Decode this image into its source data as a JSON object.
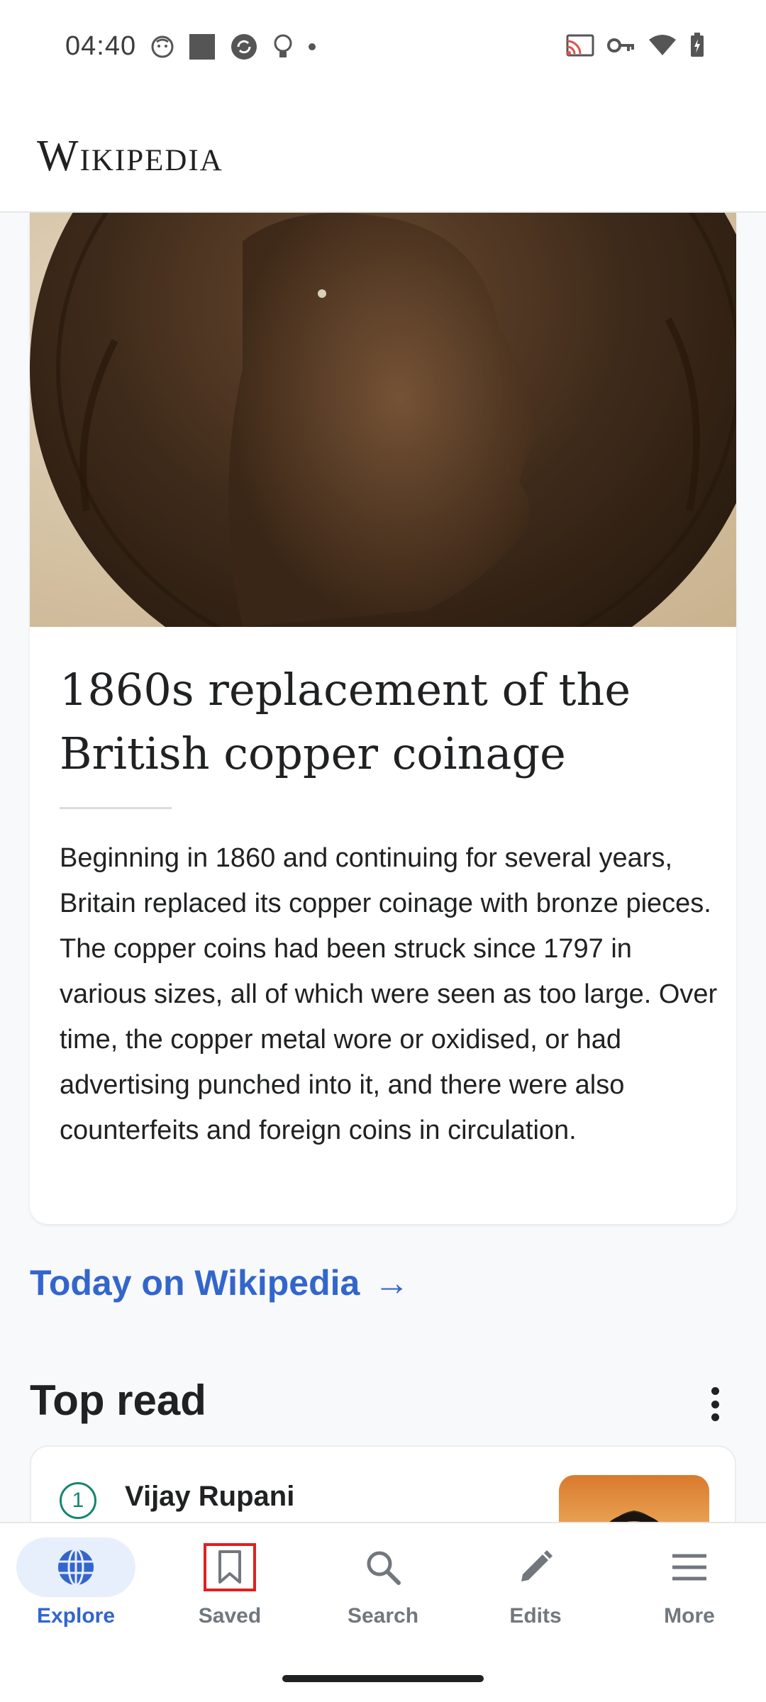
{
  "status_bar": {
    "time": "04:40"
  },
  "header": {
    "wordmark": "Wikipedia"
  },
  "featured": {
    "title": "1860s replacement of the British copper coinage",
    "extract": "Beginning in 1860 and continuing for several years, Britain replaced its copper coinage with bronze pieces. The copper coins had been struck since 1797 in various sizes, all of which were seen as too large. Over time, the copper metal wore or oxidised, or had advertising punched into it, and there were also counterfeits and foreign coins in circulation."
  },
  "today_link": {
    "label": "Today on Wikipedia",
    "arrow": "→"
  },
  "top_read": {
    "title": "Top read",
    "items": [
      {
        "rank": "1",
        "title": "Vijay Rupani"
      }
    ]
  },
  "bottom_nav": {
    "items": [
      {
        "label": "Explore",
        "icon": "globe-icon",
        "active": true
      },
      {
        "label": "Saved",
        "icon": "bookmark-icon",
        "active": false
      },
      {
        "label": "Search",
        "icon": "search-icon",
        "active": false
      },
      {
        "label": "Edits",
        "icon": "pencil-icon",
        "active": false
      },
      {
        "label": "More",
        "icon": "menu-icon",
        "active": false
      }
    ]
  },
  "colors": {
    "link": "#3366cc",
    "accent_green": "#14866d",
    "highlight": "#e02020"
  }
}
